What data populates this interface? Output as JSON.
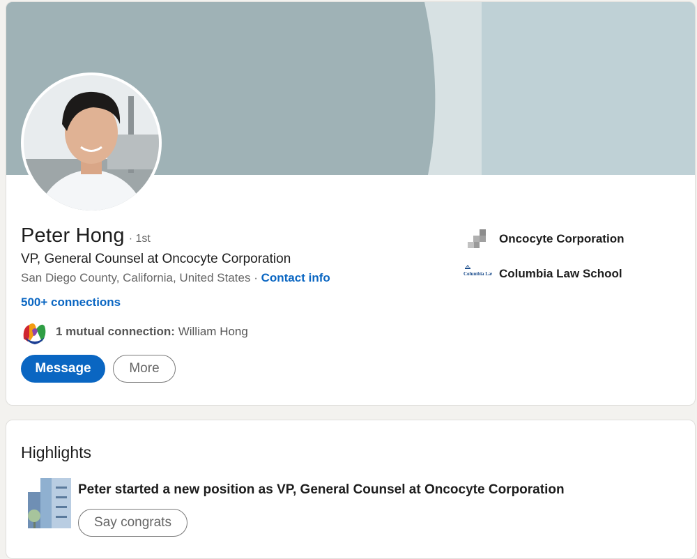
{
  "profile": {
    "name": "Peter Hong",
    "degree": "· 1st",
    "headline": "VP, General Counsel at Oncocyte Corporation",
    "location": "San Diego County, California, United States",
    "location_separator": " · ",
    "contact_info_label": "Contact info",
    "connections_label": "500+ connections",
    "mutual_prefix": "1 mutual connection:",
    "mutual_name": "William Hong",
    "buttons": {
      "message_label": "Message",
      "more_label": "More"
    },
    "current_company": "Oncocyte Corporation",
    "education": "Columbia Law School",
    "education_logo_text": "Columbia Law School"
  },
  "highlights": {
    "title": "Highlights",
    "item_text": "Peter started a new position as VP, General Counsel at Oncocyte Corporation",
    "congrats_label": "Say congrats"
  },
  "colors": {
    "accent": "#0a66c2",
    "banner_dark": "#9fb2b6",
    "banner_light": "#bfd1d6",
    "page_bg": "#f3f2ef"
  }
}
